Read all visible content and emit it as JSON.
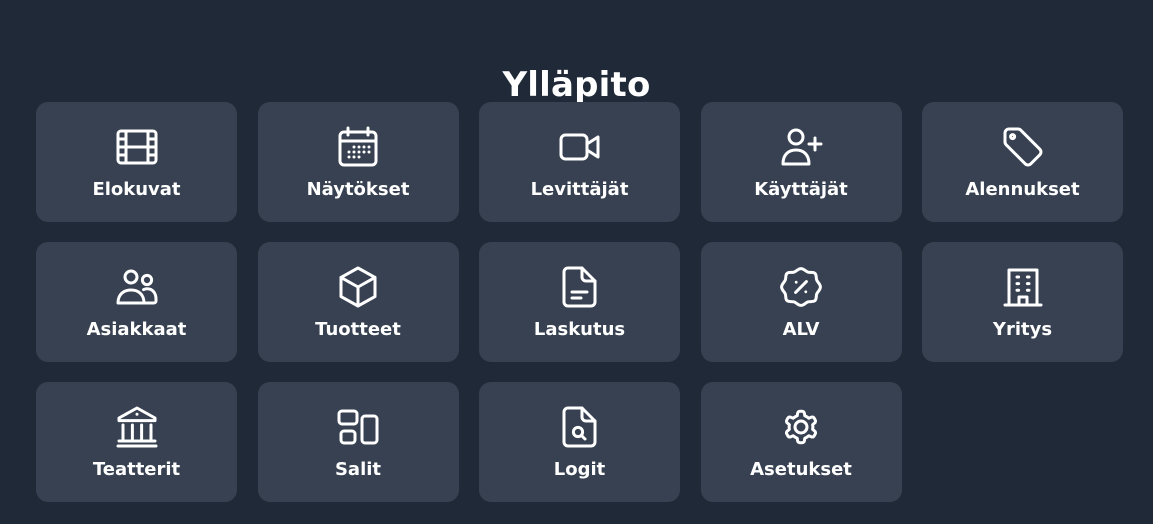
{
  "page": {
    "title": "Ylläpito"
  },
  "tiles": [
    {
      "label": "Elokuvat"
    },
    {
      "label": "Näytökset"
    },
    {
      "label": "Levittäjät"
    },
    {
      "label": "Käyttäjät"
    },
    {
      "label": "Alennukset"
    },
    {
      "label": "Asiakkaat"
    },
    {
      "label": "Tuotteet"
    },
    {
      "label": "Laskutus"
    },
    {
      "label": "ALV"
    },
    {
      "label": "Yritys"
    },
    {
      "label": "Teatterit"
    },
    {
      "label": "Salit"
    },
    {
      "label": "Logit"
    },
    {
      "label": "Asetukset"
    }
  ],
  "icons": [
    "film-icon",
    "calendar-icon",
    "video-camera-icon",
    "user-plus-icon",
    "tag-icon",
    "users-icon",
    "cube-icon",
    "document-text-icon",
    "receipt-percent-icon",
    "building-office-icon",
    "building-library-icon",
    "squares-layout-icon",
    "document-search-icon",
    "cog-icon"
  ]
}
